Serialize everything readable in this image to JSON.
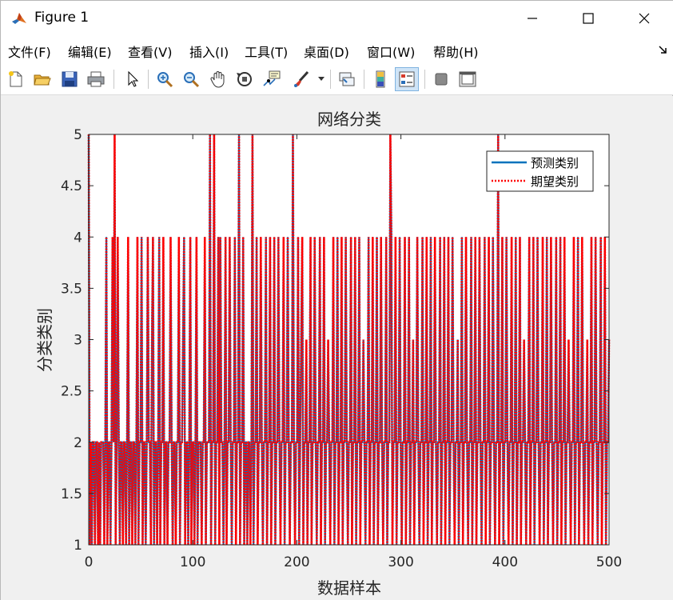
{
  "window": {
    "title": "Figure 1"
  },
  "menu": {
    "items": [
      "文件(F)",
      "编辑(E)",
      "查看(V)",
      "插入(I)",
      "工具(T)",
      "桌面(D)",
      "窗口(W)",
      "帮助(H)"
    ]
  },
  "toolbar": {
    "buttons": [
      {
        "name": "new-figure-icon"
      },
      {
        "name": "open-file-icon"
      },
      {
        "name": "save-icon"
      },
      {
        "name": "print-icon"
      },
      {
        "name": "pointer-icon"
      },
      {
        "name": "zoom-in-icon"
      },
      {
        "name": "zoom-out-icon"
      },
      {
        "name": "pan-hand-icon"
      },
      {
        "name": "rotate-3d-icon"
      },
      {
        "name": "data-cursor-icon"
      },
      {
        "name": "brush-icon"
      },
      {
        "name": "link-plot-icon"
      },
      {
        "name": "colorbar-icon"
      },
      {
        "name": "legend-icon"
      },
      {
        "name": "hide-plot-tools-icon"
      },
      {
        "name": "show-plot-tools-icon"
      }
    ]
  },
  "chart_data": {
    "type": "line",
    "title": "网络分类",
    "xlabel": "数据样本",
    "ylabel": "分类类别",
    "xlim": [
      0,
      500
    ],
    "ylim": [
      1,
      5
    ],
    "xticks": [
      "0",
      "100",
      "200",
      "300",
      "400",
      "500"
    ],
    "yticks": [
      "1",
      "1.5",
      "2",
      "2.5",
      "3",
      "3.5",
      "4",
      "4.5",
      "5"
    ],
    "legend_position": "top-right",
    "colors": {
      "predicted": "#0072bd",
      "expected": "#ff0000",
      "axis": "#262626"
    },
    "series": [
      {
        "name": "预测类别",
        "style": "solid",
        "color": "#0072bd"
      },
      {
        "name": "期望类别",
        "style": "dotted",
        "color": "#ff0000"
      }
    ],
    "category_counts_note": "values in {1,2,3,4,5}; 500 samples",
    "values": [
      5,
      1,
      2,
      1,
      2,
      2,
      1,
      2,
      2,
      1,
      2,
      1,
      2,
      2,
      2,
      1,
      2,
      4,
      1,
      2,
      2,
      1,
      2,
      4,
      2,
      5,
      1,
      2,
      4,
      2,
      1,
      2,
      2,
      1,
      2,
      2,
      1,
      2,
      4,
      1,
      2,
      2,
      1,
      2,
      2,
      1,
      2,
      4,
      1,
      2,
      2,
      4,
      1,
      2,
      2,
      1,
      2,
      4,
      2,
      2,
      1,
      3,
      4,
      1,
      2,
      2,
      1,
      2,
      4,
      1,
      2,
      2,
      4,
      1,
      2,
      2,
      1,
      2,
      2,
      4,
      2,
      1,
      2,
      2,
      1,
      2,
      2,
      4,
      1,
      2,
      2,
      3,
      4,
      1,
      2,
      2,
      1,
      2,
      4,
      1,
      2,
      2,
      1,
      2,
      4,
      1,
      2,
      2,
      2,
      1,
      2,
      2,
      4,
      1,
      2,
      2,
      2,
      5,
      1,
      2,
      2,
      5,
      1,
      2,
      2,
      4,
      1,
      4,
      2,
      2,
      1,
      2,
      4,
      1,
      2,
      2,
      4,
      2,
      1,
      2,
      2,
      4,
      1,
      2,
      2,
      5,
      1,
      2,
      2,
      4,
      1,
      2,
      2,
      1,
      2,
      2,
      1,
      2,
      5,
      1,
      2,
      2,
      4,
      1,
      2,
      2,
      4,
      2,
      1,
      2,
      2,
      4,
      1,
      2,
      2,
      4,
      1,
      2,
      2,
      4,
      1,
      2,
      2,
      4,
      2,
      1,
      2,
      2,
      4,
      1,
      2,
      2,
      4,
      2,
      1,
      2,
      2,
      5,
      2,
      1,
      2,
      2,
      4,
      1,
      2,
      3,
      4,
      1,
      2,
      2,
      3,
      1,
      2,
      2,
      4,
      1,
      2,
      2,
      4,
      2,
      1,
      2,
      2,
      4,
      1,
      2,
      2,
      4,
      1,
      2,
      2,
      3,
      2,
      1,
      2,
      2,
      4,
      1,
      2,
      2,
      4,
      1,
      2,
      2,
      4,
      1,
      2,
      2,
      4,
      2,
      1,
      2,
      2,
      4,
      1,
      2,
      2,
      4,
      1,
      2,
      2,
      4,
      1,
      2,
      2,
      3,
      2,
      1,
      2,
      2,
      4,
      1,
      2,
      2,
      4,
      1,
      2,
      2,
      4,
      1,
      2,
      2,
      4,
      2,
      1,
      2,
      2,
      4,
      1,
      2,
      2,
      5,
      4,
      1,
      2,
      2,
      4,
      1,
      2,
      2,
      4,
      2,
      1,
      2,
      2,
      4,
      1,
      2,
      2,
      4,
      1,
      2,
      2,
      3,
      1,
      2,
      2,
      4,
      2,
      1,
      2,
      2,
      4,
      1,
      2,
      2,
      4,
      1,
      2,
      2,
      4,
      1,
      2,
      2,
      4,
      2,
      1,
      2,
      2,
      4,
      1,
      2,
      2,
      4,
      1,
      2,
      2,
      4,
      1,
      2,
      2,
      4,
      2,
      1,
      2,
      2,
      3,
      1,
      2,
      2,
      4,
      1,
      2,
      2,
      4,
      2,
      1,
      2,
      2,
      4,
      1,
      2,
      2,
      4,
      1,
      2,
      2,
      4,
      2,
      1,
      2,
      2,
      4,
      1,
      2,
      2,
      4,
      1,
      2,
      2,
      4,
      2,
      1,
      2,
      2,
      5,
      1,
      2,
      2,
      4,
      1,
      2,
      2,
      4,
      2,
      1,
      2,
      2,
      4,
      1,
      2,
      2,
      4,
      1,
      2,
      2,
      4,
      1,
      2,
      2,
      3,
      2,
      1,
      2,
      2,
      4,
      1,
      2,
      2,
      4,
      1,
      2,
      2,
      4,
      2,
      1,
      2,
      2,
      4,
      1,
      2,
      2,
      4,
      1,
      2,
      2,
      4,
      2,
      1,
      2,
      2,
      4,
      1,
      2,
      2,
      4,
      1,
      2,
      2,
      4,
      1,
      2,
      2,
      3,
      2,
      1,
      2,
      2,
      4,
      1,
      2,
      2,
      4,
      1,
      2,
      2,
      4,
      2,
      1,
      2,
      2,
      3,
      1,
      2,
      2,
      4,
      1,
      2,
      2,
      4,
      2,
      1,
      2,
      2,
      4,
      1,
      2,
      2,
      4,
      1,
      2,
      2,
      3
    ]
  }
}
